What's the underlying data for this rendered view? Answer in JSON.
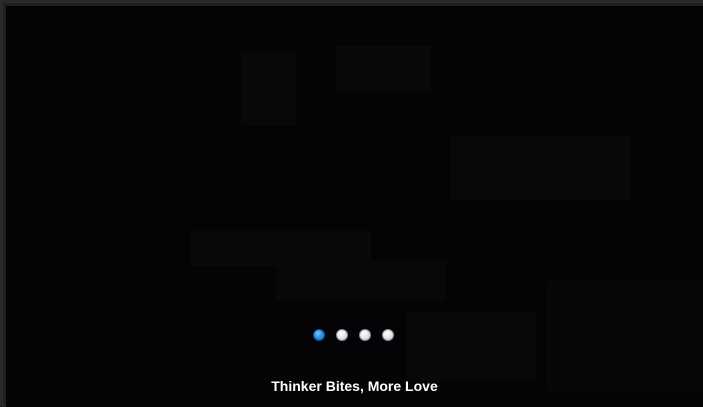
{
  "slideshow": {
    "caption": "Thinker Bites, More Love",
    "active_index": 0,
    "dot_count": 4,
    "colors": {
      "background": "#040406",
      "active_dot": "#2a8fe0",
      "inactive_dot": "#e9e9ec",
      "caption_text": "#ffffff"
    }
  }
}
